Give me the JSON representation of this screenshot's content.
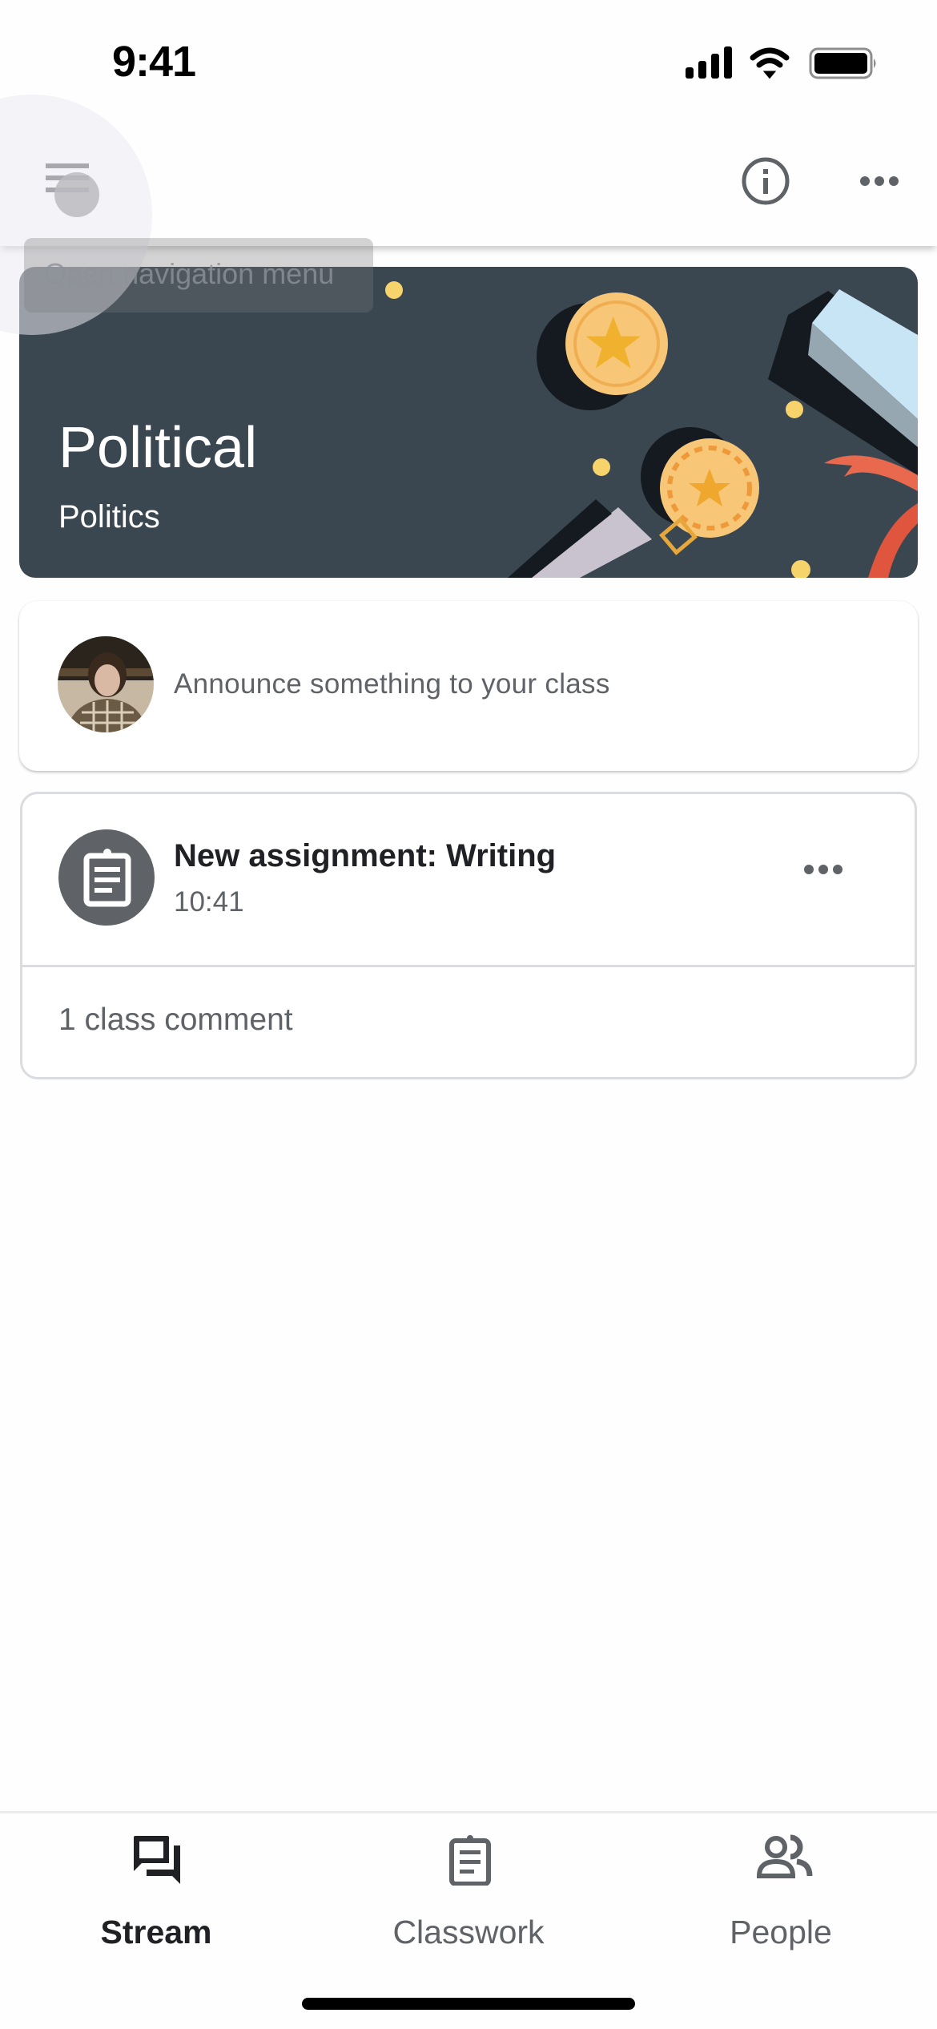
{
  "status_bar": {
    "time": "9:41",
    "icons": [
      "cellular-signal-icon",
      "wifi-icon",
      "battery-icon"
    ]
  },
  "app_bar": {
    "menu_icon": "hamburger-menu-icon",
    "info_icon": "info-icon",
    "more_icon": "more-horizontal-icon",
    "tooltip": "Open navigation menu"
  },
  "banner": {
    "title": "Political",
    "subtitle": "Politics",
    "background_color": "#3b4750"
  },
  "announce": {
    "placeholder": "Announce something to your class",
    "avatar": "user-avatar"
  },
  "stream": {
    "posts": [
      {
        "icon": "assignment-icon",
        "title": "New assignment: Writing",
        "time": "10:41",
        "comments": "1 class comment"
      }
    ]
  },
  "bottom_nav": {
    "items": [
      {
        "label": "Stream",
        "icon": "stream-icon",
        "active": true
      },
      {
        "label": "Classwork",
        "icon": "classwork-icon",
        "active": false
      },
      {
        "label": "People",
        "icon": "people-icon",
        "active": false
      }
    ]
  },
  "colors": {
    "icon_gray": "#5f6368",
    "text_primary": "#202124",
    "divider": "#dadce0"
  }
}
